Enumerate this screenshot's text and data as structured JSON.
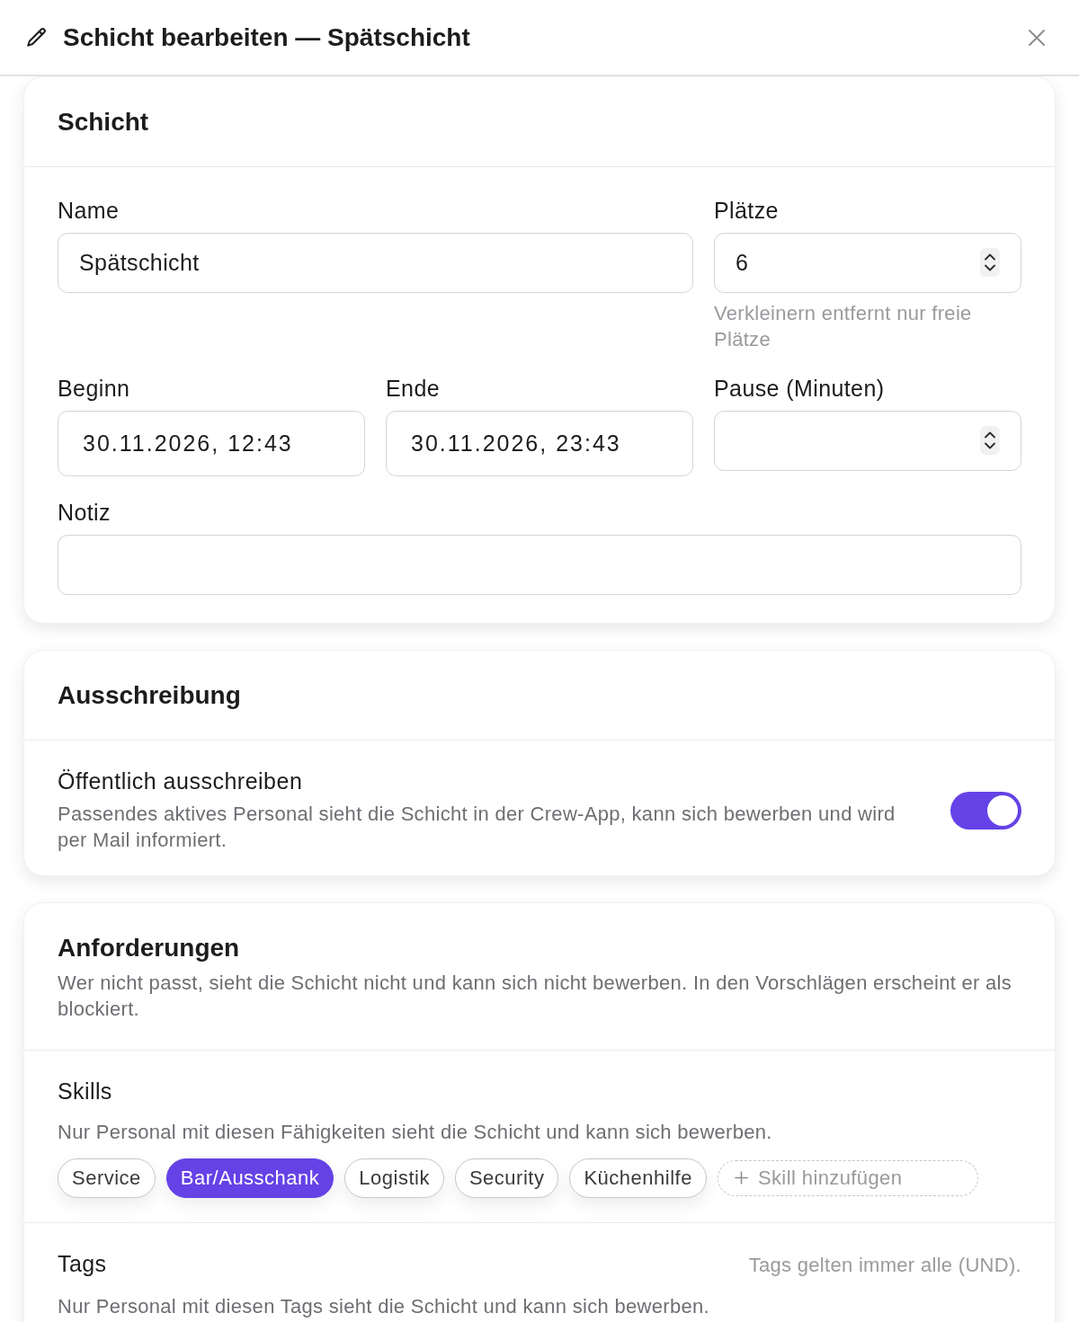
{
  "dialog": {
    "title": "Schicht bearbeiten — Spätschicht"
  },
  "sections": [
    {
      "kind": "form",
      "title": "Schicht",
      "fields": [
        {
          "kind": "text",
          "label": "Name",
          "value": "Spätschicht"
        },
        {
          "kind": "number",
          "label": "Plätze",
          "value": "6",
          "hint": "Verkleinern entfernt nur freie Plätze"
        },
        {
          "kind": "datetime",
          "label": "Beginn",
          "value": "30.11.2026, 12:43"
        },
        {
          "kind": "datetime",
          "label": "Ende",
          "value": "30.11.2026, 23:43"
        },
        {
          "kind": "number",
          "label": "Pause (Minuten)"
        },
        {
          "kind": "text",
          "label": "Notiz"
        }
      ]
    },
    {
      "kind": "toggles",
      "title": "Ausschreibung",
      "toggles": [
        {
          "label": "Öffentlich ausschreiben",
          "description": "Passendes aktives Personal sieht die Schicht in der Crew-App, kann sich bewerben und wird per Mail informiert.",
          "on": true
        }
      ]
    },
    {
      "kind": "requirements",
      "title": "Anforderungen",
      "description": "Wer nicht passt, sieht die Schicht nicht und kann sich nicht bewerben. In den Vorschlägen erscheint er als blockiert.",
      "groups": [
        {
          "title": "Skills",
          "description": "Nur Personal mit diesen Fähigkeiten sieht die Schicht und kann sich bewerben.",
          "chips": [
            {
              "label": "Service",
              "selected": false
            },
            {
              "label": "Bar/Ausschank",
              "selected": true
            },
            {
              "label": "Logistik",
              "selected": false
            },
            {
              "label": "Security",
              "selected": false
            },
            {
              "label": "Küchenhilfe",
              "selected": false
            }
          ],
          "add_placeholder": "Skill hinzufügen"
        },
        {
          "title": "Tags",
          "note": "Tags gelten immer alle (UND).",
          "description": "Nur Personal mit diesen Tags sieht die Schicht und kann sich bewerben."
        }
      ]
    }
  ]
}
